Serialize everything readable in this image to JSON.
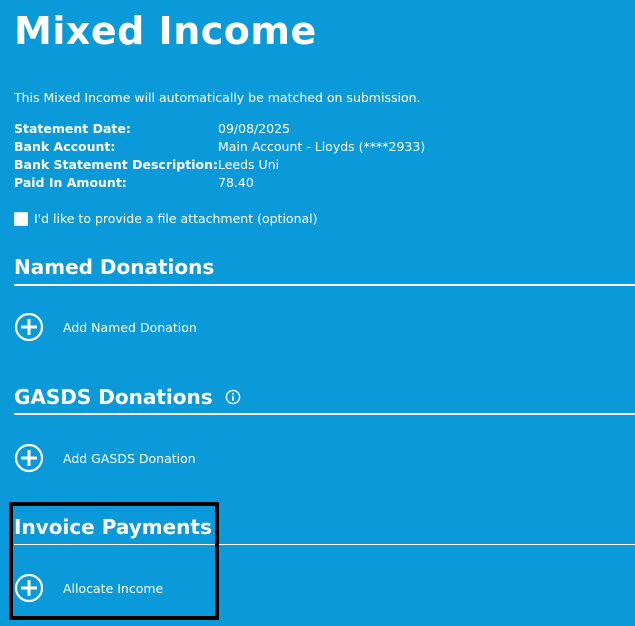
{
  "page": {
    "title": "Mixed Income",
    "intro": "This Mixed Income will automatically be matched on submission."
  },
  "details": [
    {
      "label": "Statement Date:",
      "value": "09/08/2025"
    },
    {
      "label": "Bank Account:",
      "value": "Main Account - Lloyds (****2933)"
    },
    {
      "label": "Bank Statement Description:",
      "value": "Leeds Uni"
    },
    {
      "label": "Paid In Amount:",
      "value": "78.40"
    }
  ],
  "attachment": {
    "label": "I'd like to provide a file attachment (optional)",
    "checked": false
  },
  "sections": {
    "named": {
      "title": "Named Donations",
      "action": "Add Named Donation"
    },
    "gasds": {
      "title": "GASDS Donations",
      "action": "Add GASDS Donation"
    },
    "invoice": {
      "title": "Invoice Payments",
      "action": "Allocate Income"
    }
  },
  "icons": {
    "add": "plus-circle-icon",
    "info": "info-icon"
  },
  "colors": {
    "background": "#0a9ad9",
    "text": "#ffffff",
    "highlight": "#000000"
  }
}
